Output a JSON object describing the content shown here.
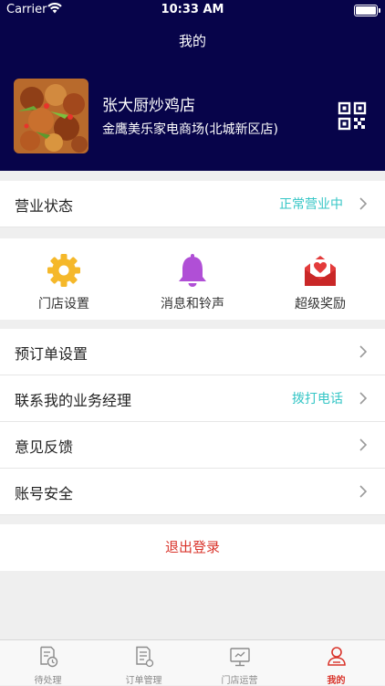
{
  "status_bar": {
    "carrier": "Carrier",
    "time": "10:33 AM",
    "battery_level": 1.0
  },
  "header": {
    "title": "我的"
  },
  "store": {
    "name": "张大厨炒鸡店",
    "address": "金鹰美乐家电商场(北城新区店)"
  },
  "business_status": {
    "label": "营业状态",
    "value": "正常营业中"
  },
  "quick_actions": [
    {
      "label": "门店设置",
      "icon": "gear-icon",
      "color": "#f5b82a"
    },
    {
      "label": "消息和铃声",
      "icon": "bell-icon",
      "color": "#b04fd6"
    },
    {
      "label": "超级奖励",
      "icon": "reward-envelope-icon",
      "color": "#e33b3b"
    }
  ],
  "menu": [
    {
      "label": "预订单设置",
      "value": ""
    },
    {
      "label": "联系我的业务经理",
      "value": "拨打电话"
    },
    {
      "label": "意见反馈",
      "value": ""
    },
    {
      "label": "账号安全",
      "value": ""
    }
  ],
  "logout": {
    "label": "退出登录"
  },
  "tabbar": [
    {
      "label": "待处理",
      "icon": "pending-clock-icon",
      "active": false
    },
    {
      "label": "订单管理",
      "icon": "order-list-icon",
      "active": false
    },
    {
      "label": "门店运营",
      "icon": "monitor-icon",
      "active": false
    },
    {
      "label": "我的",
      "icon": "person-icon",
      "active": true
    }
  ],
  "colors": {
    "header_bg": "#07044a",
    "accent_teal": "#35c6c6",
    "accent_red": "#d9342b"
  }
}
